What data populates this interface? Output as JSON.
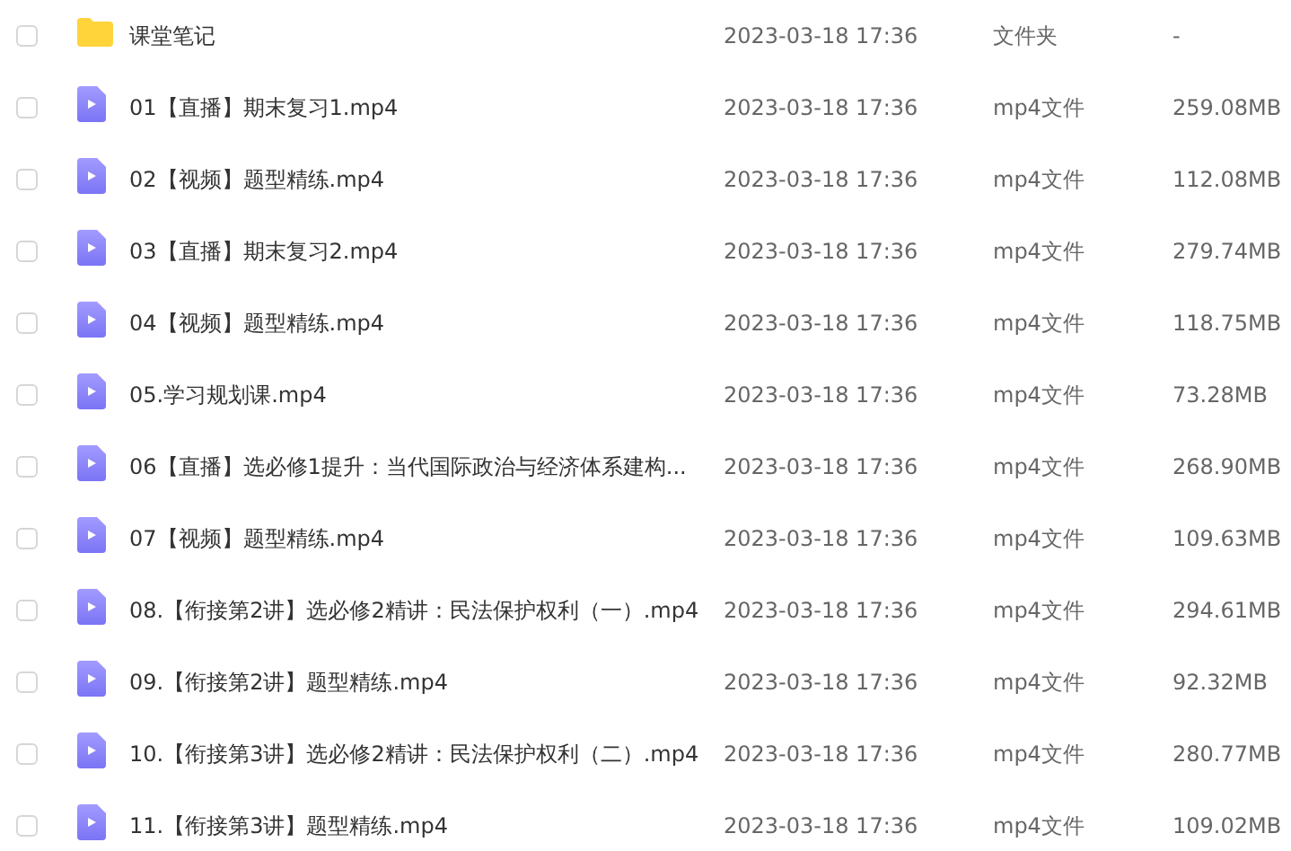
{
  "files": [
    {
      "kind": "folder",
      "checked": false,
      "name": "课堂笔记",
      "date": "2023-03-18 17:36",
      "type": "文件夹",
      "size": "-"
    },
    {
      "kind": "video",
      "checked": false,
      "name": "01【直播】期末复习1.mp4",
      "date": "2023-03-18 17:36",
      "type": "mp4文件",
      "size": "259.08MB"
    },
    {
      "kind": "video",
      "checked": false,
      "name": "02【视频】题型精练.mp4",
      "date": "2023-03-18 17:36",
      "type": "mp4文件",
      "size": "112.08MB"
    },
    {
      "kind": "video",
      "checked": false,
      "name": "03【直播】期末复习2.mp4",
      "date": "2023-03-18 17:36",
      "type": "mp4文件",
      "size": "279.74MB"
    },
    {
      "kind": "video",
      "checked": false,
      "name": "04【视频】题型精练.mp4",
      "date": "2023-03-18 17:36",
      "type": "mp4文件",
      "size": "118.75MB"
    },
    {
      "kind": "video",
      "checked": false,
      "name": "05.学习规划课.mp4",
      "date": "2023-03-18 17:36",
      "type": "mp4文件",
      "size": "73.28MB"
    },
    {
      "kind": "video",
      "checked": false,
      "name": "06【直播】选必修1提升：当代国际政治与经济体系建构...",
      "date": "2023-03-18 17:36",
      "type": "mp4文件",
      "size": "268.90MB"
    },
    {
      "kind": "video",
      "checked": false,
      "name": "07【视频】题型精练.mp4",
      "date": "2023-03-18 17:36",
      "type": "mp4文件",
      "size": "109.63MB"
    },
    {
      "kind": "video",
      "checked": false,
      "name": "08.【衔接第2讲】选必修2精讲：民法保护权利（一）.mp4",
      "date": "2023-03-18 17:36",
      "type": "mp4文件",
      "size": "294.61MB"
    },
    {
      "kind": "video",
      "checked": false,
      "name": "09.【衔接第2讲】题型精练.mp4",
      "date": "2023-03-18 17:36",
      "type": "mp4文件",
      "size": "92.32MB"
    },
    {
      "kind": "video",
      "checked": false,
      "name": "10.【衔接第3讲】选必修2精讲：民法保护权利（二）.mp4",
      "date": "2023-03-18 17:36",
      "type": "mp4文件",
      "size": "280.77MB"
    },
    {
      "kind": "video",
      "checked": false,
      "name": "11.【衔接第3讲】题型精练.mp4",
      "date": "2023-03-18 17:36",
      "type": "mp4文件",
      "size": "109.02MB"
    }
  ]
}
